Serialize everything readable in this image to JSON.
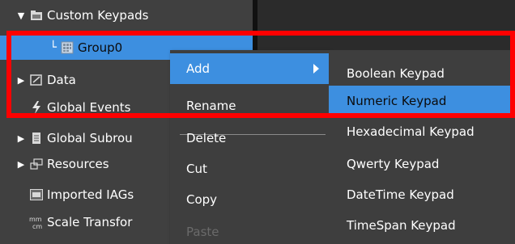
{
  "tree": {
    "items": [
      {
        "label": "Custom Keypads",
        "icon": "folder-icon",
        "arrow": "▼"
      },
      {
        "label": "Group0",
        "icon": "keypad-group-icon",
        "arrow": "",
        "connector": "└"
      },
      {
        "label": "Data",
        "icon": "data-icon",
        "arrow": "▶"
      },
      {
        "label": "Global Events",
        "icon": "lightning-icon",
        "arrow": ""
      },
      {
        "label": "Global Subrou",
        "icon": "document-icon",
        "arrow": "▶"
      },
      {
        "label": "Resources",
        "icon": "resources-icon",
        "arrow": "▶"
      },
      {
        "label": "Imported IAGs",
        "icon": "iag-icon",
        "arrow": ""
      },
      {
        "label": "Scale Transfor",
        "icon": "scale-transform-icon",
        "arrow": ""
      }
    ]
  },
  "context_menu": {
    "items": [
      {
        "label": "Add",
        "state": "active"
      },
      {
        "label": "Rename",
        "state": "normal"
      },
      {
        "label": "Delete",
        "state": "normal"
      },
      {
        "label": "Cut",
        "state": "normal"
      },
      {
        "label": "Copy",
        "state": "normal"
      },
      {
        "label": "Paste",
        "state": "disabled"
      }
    ]
  },
  "submenu": {
    "items": [
      {
        "label": "Boolean Keypad",
        "state": "normal"
      },
      {
        "label": "Numeric Keypad",
        "state": "active"
      },
      {
        "label": "Hexadecimal Keypad",
        "state": "normal"
      },
      {
        "label": "Qwerty Keypad",
        "state": "normal"
      },
      {
        "label": "DateTime Keypad",
        "state": "normal"
      },
      {
        "label": "TimeSpan Keypad",
        "state": "normal"
      }
    ]
  },
  "colors": {
    "selection": "#3d8fe0",
    "highlight": "#ff0000",
    "pane": "#404040",
    "menu": "#3e3e3e"
  }
}
